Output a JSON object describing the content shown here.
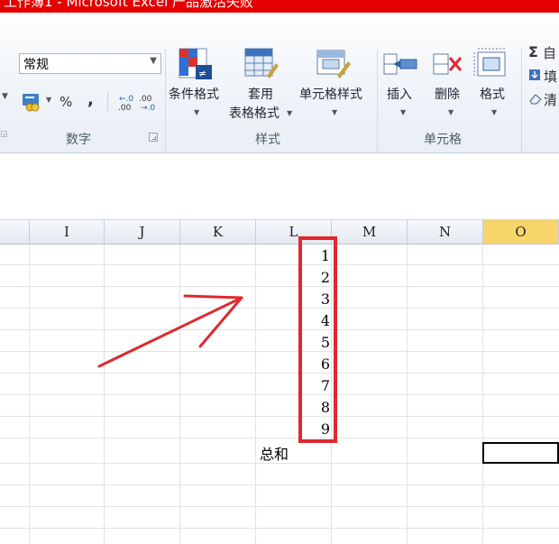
{
  "window": {
    "title": "工作簿1 - Microsoft Excel 产品激活失败"
  },
  "ribbon": {
    "number_format": "常规",
    "percent_label": "%",
    "comma_label": ",",
    "groups": {
      "number": "数字",
      "styles": "样式",
      "cells": "单元格"
    },
    "buttons": {
      "conditional_format": "条件格式",
      "format_table_line1": "套用",
      "format_table_line2": "表格格式",
      "cell_styles": "单元格样式",
      "insert": "插入",
      "delete": "删除",
      "format": "格式"
    },
    "editing": {
      "autosum": "自",
      "fill": "填",
      "clear": "清"
    }
  },
  "sheet": {
    "columns": [
      "I",
      "J",
      "K",
      "L",
      "M",
      "N",
      "O"
    ],
    "selected_column": "O",
    "values": [
      "1",
      "2",
      "3",
      "4",
      "5",
      "6",
      "7",
      "8",
      "9"
    ],
    "sum_label": "总和"
  },
  "colors": {
    "title_bar": "#e40000",
    "highlight_box": "#e0282f",
    "arrow": "#e0282f",
    "selected_header": "#f8d56b"
  }
}
